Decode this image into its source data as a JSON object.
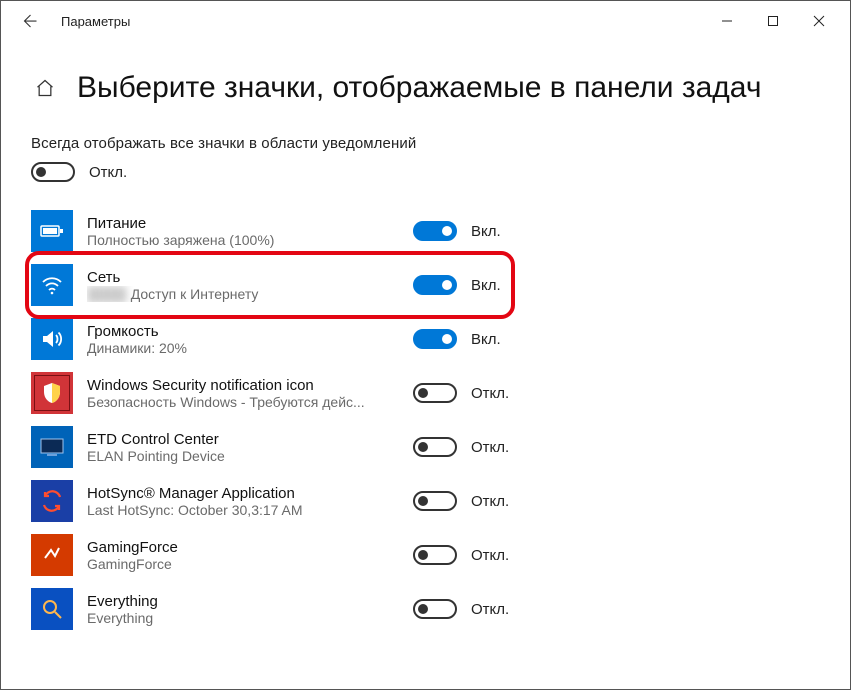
{
  "window": {
    "app_title": "Параметры"
  },
  "page": {
    "title": "Выберите значки, отображаемые в панели задач"
  },
  "always": {
    "label": "Всегда отображать все значки в области уведомлений",
    "state": "Откл.",
    "on": false
  },
  "states": {
    "on": "Вкл.",
    "off": "Откл."
  },
  "items": [
    {
      "title": "Питание",
      "sub": "Полностью заряжена (100%)",
      "on": true,
      "icon": "battery"
    },
    {
      "title": "Сеть",
      "sub_prefix": "████",
      "sub": "Доступ к Интернету",
      "on": true,
      "icon": "wifi",
      "highlight": true
    },
    {
      "title": "Громкость",
      "sub": "Динамики: 20%",
      "on": true,
      "icon": "speaker"
    },
    {
      "title": "Windows Security notification icon",
      "sub": "Безопасность Windows - Требуются дейс...",
      "on": false,
      "icon": "security"
    },
    {
      "title": "ETD Control Center",
      "sub": "ELAN Pointing Device",
      "on": false,
      "icon": "etd"
    },
    {
      "title": "HotSync® Manager Application",
      "sub": "Last HotSync: October 30,3:17 AM",
      "on": false,
      "icon": "hotsync"
    },
    {
      "title": "GamingForce",
      "sub": "GamingForce",
      "on": false,
      "icon": "gf"
    },
    {
      "title": "Everything",
      "sub": "Everything",
      "on": false,
      "icon": "ev"
    }
  ]
}
